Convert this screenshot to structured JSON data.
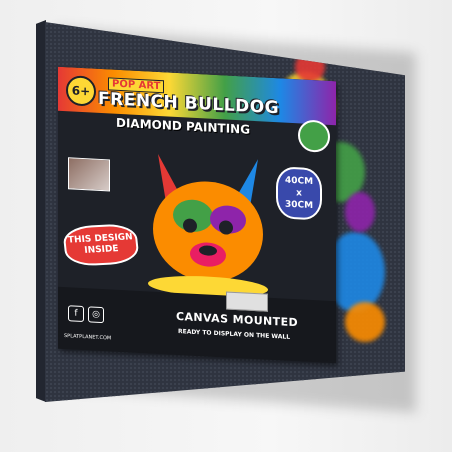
{
  "product": {
    "age": "6+",
    "tagline": "POP ART",
    "title": "FRENCH BULLDOG",
    "subtitle": "DIAMOND PAINTING",
    "size_top": "40CM",
    "size_x": "x",
    "size_bottom": "30CM",
    "design_line1": "THIS DESIGN",
    "design_line2": "INSIDE",
    "mounted": "CANVAS MOUNTED",
    "ready": "READY TO DISPLAY ON THE WALL",
    "website": "SPLATPLANET.COM",
    "social": [
      "f",
      "◎"
    ]
  },
  "colors": {
    "canvas": "#2f3440",
    "box": "#1e2128",
    "accent_red": "#e53935",
    "accent_yellow": "#fdd835",
    "accent_blue": "#1e88e5",
    "accent_green": "#43a047",
    "accent_purple": "#8e24aa"
  }
}
